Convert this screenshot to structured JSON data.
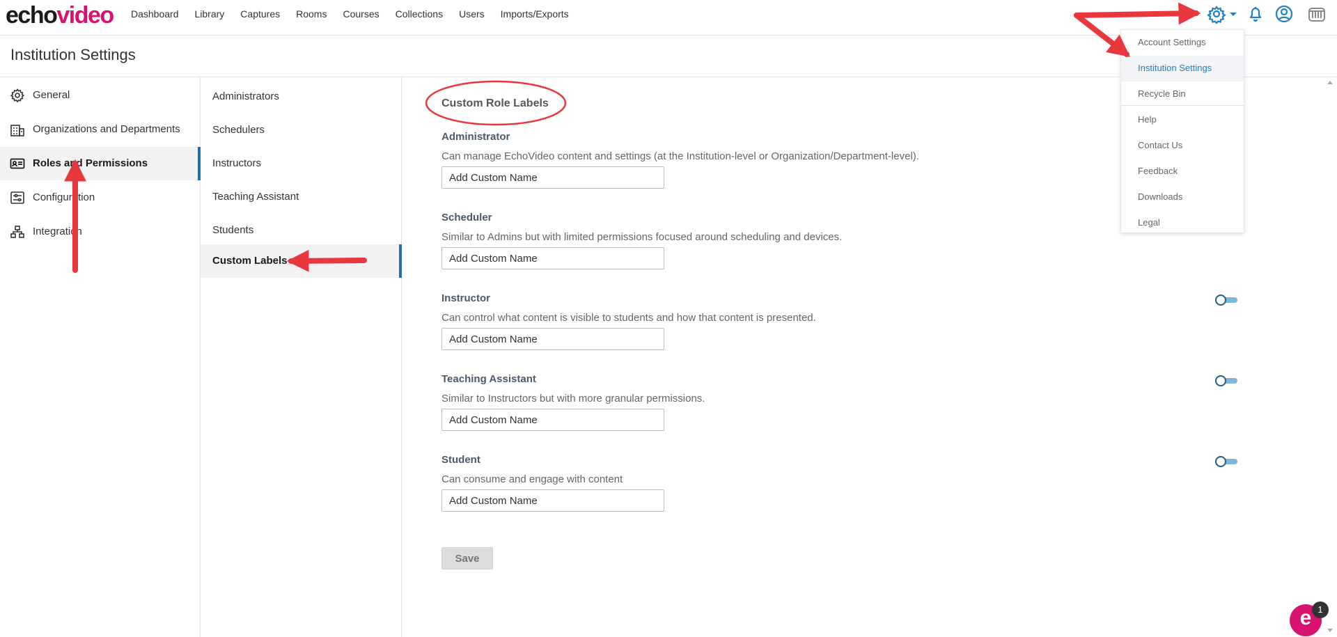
{
  "brand": {
    "logo_part1": "echo",
    "logo_part2": "video"
  },
  "nav": {
    "items": [
      "Dashboard",
      "Library",
      "Captures",
      "Rooms",
      "Courses",
      "Collections",
      "Users",
      "Imports/Exports"
    ]
  },
  "top_icons": [
    "gear-icon",
    "caret-down-icon",
    "bell-icon",
    "user-circle-icon",
    "institution-logo-icon"
  ],
  "page": {
    "title": "Institution Settings"
  },
  "sidebar": {
    "items": [
      {
        "label": "General",
        "icon": "gear-icon"
      },
      {
        "label": "Organizations and Departments",
        "icon": "building-icon"
      },
      {
        "label": "Roles and Permissions",
        "icon": "id-card-icon",
        "active": true
      },
      {
        "label": "Configuration",
        "icon": "sliders-icon"
      },
      {
        "label": "Integration",
        "icon": "network-icon"
      }
    ]
  },
  "subnav": {
    "items": [
      {
        "label": "Administrators"
      },
      {
        "label": "Schedulers"
      },
      {
        "label": "Instructors"
      },
      {
        "label": "Teaching Assistant"
      },
      {
        "label": "Students"
      },
      {
        "label": "Custom Labels",
        "active": true
      }
    ]
  },
  "main": {
    "section_title": "Custom Role Labels",
    "roles": [
      {
        "name": "Administrator",
        "description": "Can manage EchoVideo content and settings (at the Institution-level or Organization/Department-level).",
        "placeholder": "Add Custom Name",
        "toggle": false
      },
      {
        "name": "Scheduler",
        "description": "Similar to Admins but with limited permissions focused around scheduling and devices.",
        "placeholder": "Add Custom Name",
        "toggle": false
      },
      {
        "name": "Instructor",
        "description": "Can control what content is visible to students and how that content is presented.",
        "placeholder": "Add Custom Name",
        "toggle": true
      },
      {
        "name": "Teaching Assistant",
        "description": "Similar to Instructors but with more granular permissions.",
        "placeholder": "Add Custom Name",
        "toggle": true
      },
      {
        "name": "Student",
        "description": "Can consume and engage with content",
        "placeholder": "Add Custom Name",
        "toggle": true
      }
    ],
    "save_label": "Save"
  },
  "menu": {
    "items": [
      {
        "label": "Account Settings"
      },
      {
        "label": "Institution Settings",
        "active": true
      },
      {
        "label": "Recycle Bin"
      },
      {
        "label": "Help"
      },
      {
        "label": "Contact Us"
      },
      {
        "label": "Feedback"
      },
      {
        "label": "Downloads"
      },
      {
        "label": "Legal"
      }
    ]
  },
  "chat": {
    "glyph": "e",
    "badge": "1"
  },
  "colors": {
    "brand_pink": "#d8136f",
    "accent_blue": "#1d6fa8",
    "menu_active": "#1d7fc4",
    "annotation_red": "#e8383d"
  }
}
